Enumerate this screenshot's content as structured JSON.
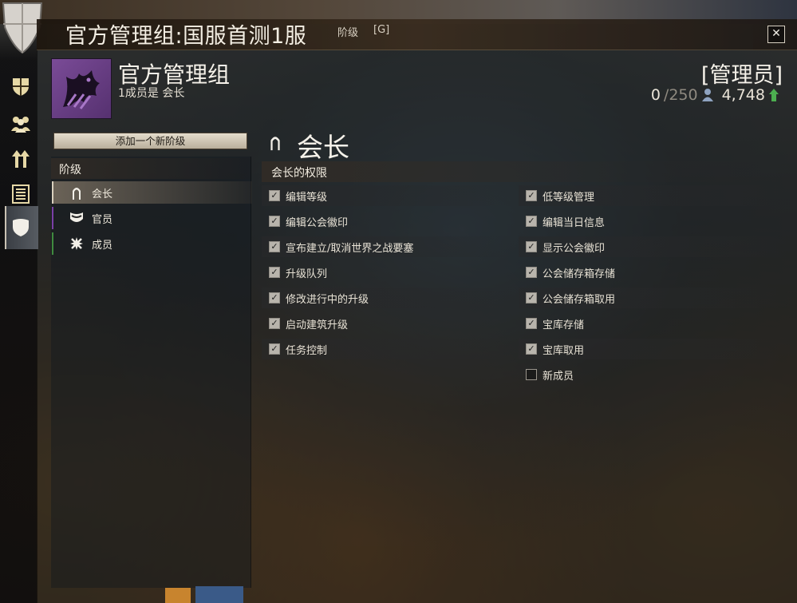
{
  "window": {
    "title": "官方管理组:国服首测1服",
    "tag_rank": "阶级",
    "tag_g": "[G]",
    "close_label": "✕"
  },
  "header": {
    "guild_name": "官方管理组",
    "member_line": "1成员是 会长",
    "rank_label": "[管理员]",
    "members_count": "0",
    "members_cap": "/250",
    "influence": "4,748"
  },
  "left_panel": {
    "add_rank_button": "添加一个新阶级",
    "ranks_header": "阶级",
    "ranks": [
      {
        "label": "会长"
      },
      {
        "label": "官员"
      },
      {
        "label": "成员"
      }
    ]
  },
  "rank_detail": {
    "title": "会长",
    "permissions_header": "会长的权限",
    "left_permissions": [
      {
        "label": "编辑等级",
        "checked": true
      },
      {
        "label": "编辑公会徽印",
        "checked": true
      },
      {
        "label": "宣布建立/取消世界之战要塞",
        "checked": true
      },
      {
        "label": "升级队列",
        "checked": true
      },
      {
        "label": "修改进行中的升级",
        "checked": true
      },
      {
        "label": "启动建筑升级",
        "checked": true
      },
      {
        "label": "任务控制",
        "checked": true
      }
    ],
    "right_permissions": [
      {
        "label": "低等级管理",
        "checked": true
      },
      {
        "label": "编辑当日信息",
        "checked": true
      },
      {
        "label": "显示公会徽印",
        "checked": true
      },
      {
        "label": "公会储存箱存储",
        "checked": true
      },
      {
        "label": "公会储存箱取用",
        "checked": true
      },
      {
        "label": "宝库存储",
        "checked": true
      },
      {
        "label": "宝库取用",
        "checked": true
      },
      {
        "label": "新成员",
        "checked": false
      }
    ]
  },
  "icons": {
    "crest": "guild-crest-icon",
    "rail": [
      "guild-shield-icon",
      "roster-icon",
      "upgrades-icon",
      "log-icon",
      "emblem-shield-icon"
    ],
    "emblem": "dragon-emblem-icon",
    "member": "member-icon",
    "influence": "influence-icon"
  },
  "colors": {
    "emblem_bg": "#6a3f88",
    "officer_accent": "#7a3fa6",
    "member_accent": "#3f8a3f",
    "influence_green": "#4caf50"
  }
}
